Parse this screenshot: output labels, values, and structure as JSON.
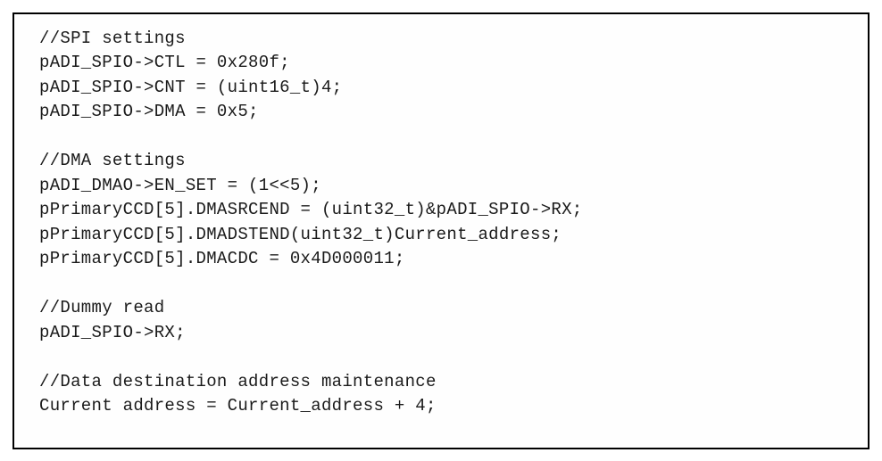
{
  "code": {
    "lines": [
      "//SPI settings",
      "pADI_SPIO->CTL = 0x280f;",
      "pADI_SPIO->CNT = (uint16_t)4;",
      "pADI_SPIO->DMA = 0x5;",
      "",
      "//DMA settings",
      "pADI_DMAO->EN_SET = (1<<5);",
      "pPrimaryCCD[5].DMASRCEND = (uint32_t)&pADI_SPIO->RX;",
      "pPrimaryCCD[5].DMADSTEND(uint32_t)Current_address;",
      "pPrimaryCCD[5].DMACDC = 0x4D000011;",
      "",
      "//Dummy read",
      "pADI_SPIO->RX;",
      "",
      "//Data destination address maintenance",
      "Current address = Current_address + 4;"
    ]
  }
}
